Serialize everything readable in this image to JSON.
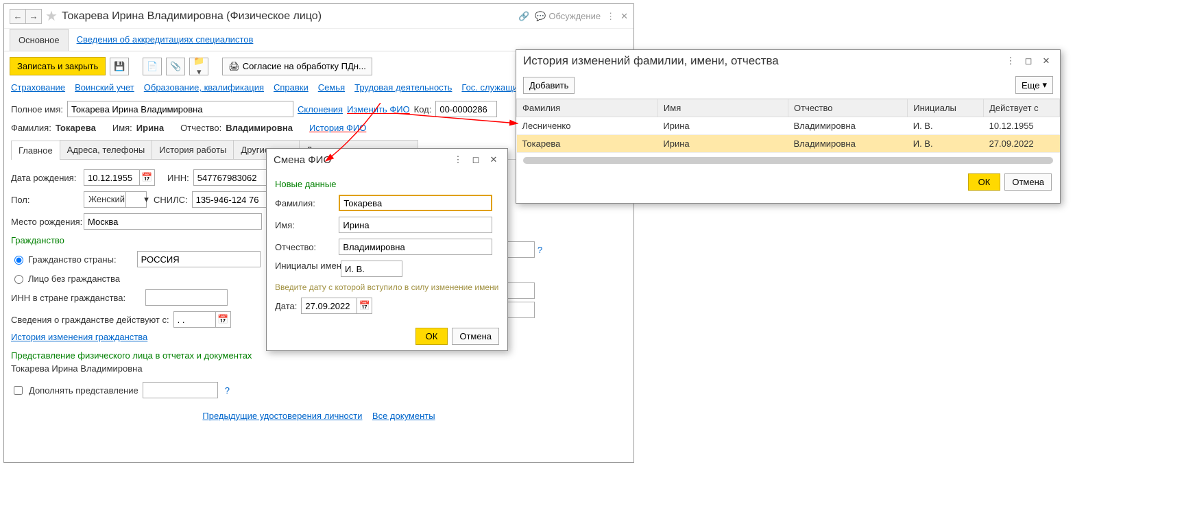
{
  "header": {
    "title": "Токарева Ирина Владимировна (Физическое лицо)",
    "discuss": "Обсуждение"
  },
  "top_tabs": {
    "main": "Основное",
    "accred": "Сведения об аккредитациях специалистов"
  },
  "cmd": {
    "save_close": "Записать и закрыть",
    "consent": "Согласие на обработку ПДн..."
  },
  "links1": {
    "insurance": "Страхование",
    "military": "Воинский учет",
    "education": "Образование, квалификация",
    "spravki": "Справки",
    "family": "Семья",
    "labor": "Трудовая деятельность",
    "gos": "Гос. служащий"
  },
  "full_name_row": {
    "label": "Полное имя:",
    "value": "Токарева Ирина Владимировна",
    "sklon": "Склонения",
    "change": "Изменить ФИО",
    "code_label": "Код:",
    "code": "00-0000286"
  },
  "fio_row": {
    "fam_label": "Фамилия:",
    "fam": "Токарева",
    "imya_label": "Имя:",
    "imya": "Ирина",
    "otch_label": "Отчество:",
    "otch": "Владимировна",
    "history": "История ФИО"
  },
  "sub_tabs": {
    "g": "Главное",
    "a": "Адреса, телефоны",
    "i": "История работы",
    "d": "Другие роли",
    "dop": "Дополнительные данные"
  },
  "form": {
    "dob_label": "Дата рождения:",
    "dob": "10.12.1955",
    "inn_label": "ИНН:",
    "inn": "547767983062",
    "pol_label": "Пол:",
    "pol": "Женский",
    "snils_label": "СНИЛС:",
    "snils": "135-946-124 76",
    "birthplace_label": "Место рождения:",
    "birthplace": "Москва",
    "citizenship_grp": "Гражданство",
    "citizen_country": "Гражданство страны:",
    "no_citizen": "Лицо без гражданства",
    "country": "РОССИЯ",
    "inn_foreign": "ИНН в стране гражданства:",
    "citizen_from": "Сведения о гражданстве действуют с:",
    "citizen_dots": ". .",
    "citizen_history": "История изменения гражданства",
    "repr_title": "Представление физического лица в отчетах и документах",
    "repr_value": "Токарева Ирина Владимировна",
    "supplement": "Дополнять представление",
    "prev_docs": "Предыдущие удостоверения личности",
    "all_docs": "Все документы"
  },
  "change_fio": {
    "title": "Смена ФИО",
    "new_data": "Новые данные",
    "fam_label": "Фамилия:",
    "fam": "Токарева",
    "imya_label": "Имя:",
    "imya": "Ирина",
    "otch_label": "Отчество:",
    "otch": "Владимировна",
    "init_label": "Инициалы имени, отчества:",
    "init": "И. В.",
    "hint": "Введите дату с которой вступило в силу изменение имени",
    "date_label": "Дата:",
    "date": "27.09.2022",
    "ok": "ОК",
    "cancel": "Отмена"
  },
  "history": {
    "title": "История изменений фамилии, имени, отчества",
    "add": "Добавить",
    "more": "Еще",
    "cols": {
      "fam": "Фамилия",
      "imya": "Имя",
      "otch": "Отчество",
      "init": "Инициалы",
      "from": "Действует с"
    },
    "rows": [
      {
        "fam": "Лесниченко",
        "imya": "Ирина",
        "otch": "Владимировна",
        "init": "И. В.",
        "from": "10.12.1955"
      },
      {
        "fam": "Токарева",
        "imya": "Ирина",
        "otch": "Владимировна",
        "init": "И. В.",
        "from": "27.09.2022"
      }
    ],
    "ok": "ОК",
    "cancel": "Отмена"
  }
}
